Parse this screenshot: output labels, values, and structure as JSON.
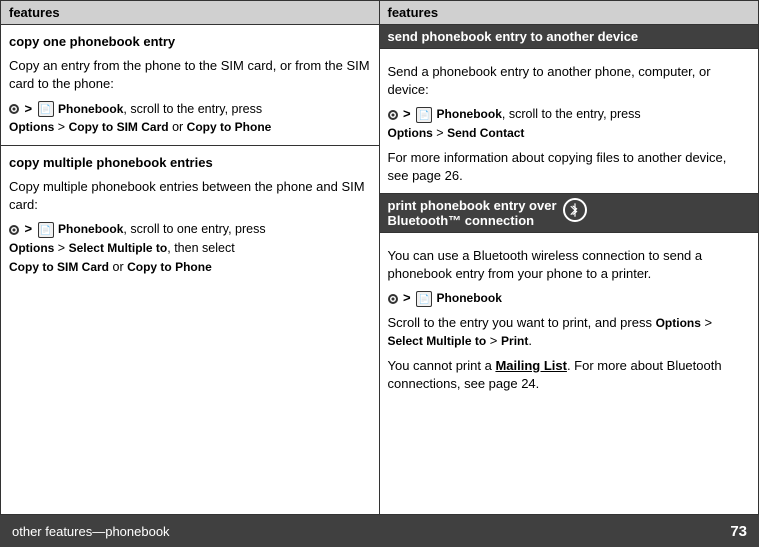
{
  "left": {
    "header_label": "features",
    "section1": {
      "title": "copy one phonebook entry",
      "body1": "Copy an entry from the phone to the SIM card, or from the SIM card to the phone:",
      "instruction": " > ",
      "phonebook_label": "Phonebook",
      "instr_suffix": ", scroll to the entry, press",
      "options_label": "Options",
      "menu_sep": " > ",
      "copy_sim": "Copy to SIM Card",
      "or_label": " or ",
      "copy_phone": "Copy to Phone"
    },
    "section2": {
      "title": "copy multiple phonebook entries",
      "body1": "Copy multiple phonebook entries between the phone and SIM card:",
      "instruction": " > ",
      "phonebook_label": "Phonebook",
      "instr_suffix": ", scroll to one entry, press",
      "options_label": "Options",
      "menu_sep": " > ",
      "select_multiple": "Select Multiple to",
      "then_select": ", then select",
      "copy_sim": "Copy to SIM Card",
      "or_label": " or ",
      "copy_phone": "Copy to Phone"
    }
  },
  "right": {
    "header_label": "features",
    "section1": {
      "title": "send phonebook entry to another device",
      "body1": "Send a phonebook entry to another phone, computer, or device:",
      "instruction": " > ",
      "phonebook_label": "Phonebook",
      "instr_suffix": ", scroll to the entry, press",
      "options_label": "Options",
      "menu_sep": " > ",
      "send_contact": "Send Contact",
      "body2": "For more information about copying files to another device, see page 26."
    },
    "section2": {
      "title_line1": "print phonebook entry over",
      "title_line2": "Bluetooth™ connection",
      "body1": "You can use a Bluetooth wireless connection to send a phonebook entry from your phone to a printer.",
      "phonebook_label": "Phonebook",
      "body2": "Scroll to the entry you want to print, and press",
      "options_label": "Options",
      "menu_sep": " > ",
      "select_multiple": "Select Multiple to",
      "menu_sep2": " > ",
      "print_label": "Print",
      "body3_prefix": "You cannot print a ",
      "mailing_list": "Mailing List",
      "body3_suffix": ". For more about Bluetooth connections, see page 24."
    }
  },
  "footer": {
    "label": "other features—phonebook",
    "page_number": "73"
  }
}
